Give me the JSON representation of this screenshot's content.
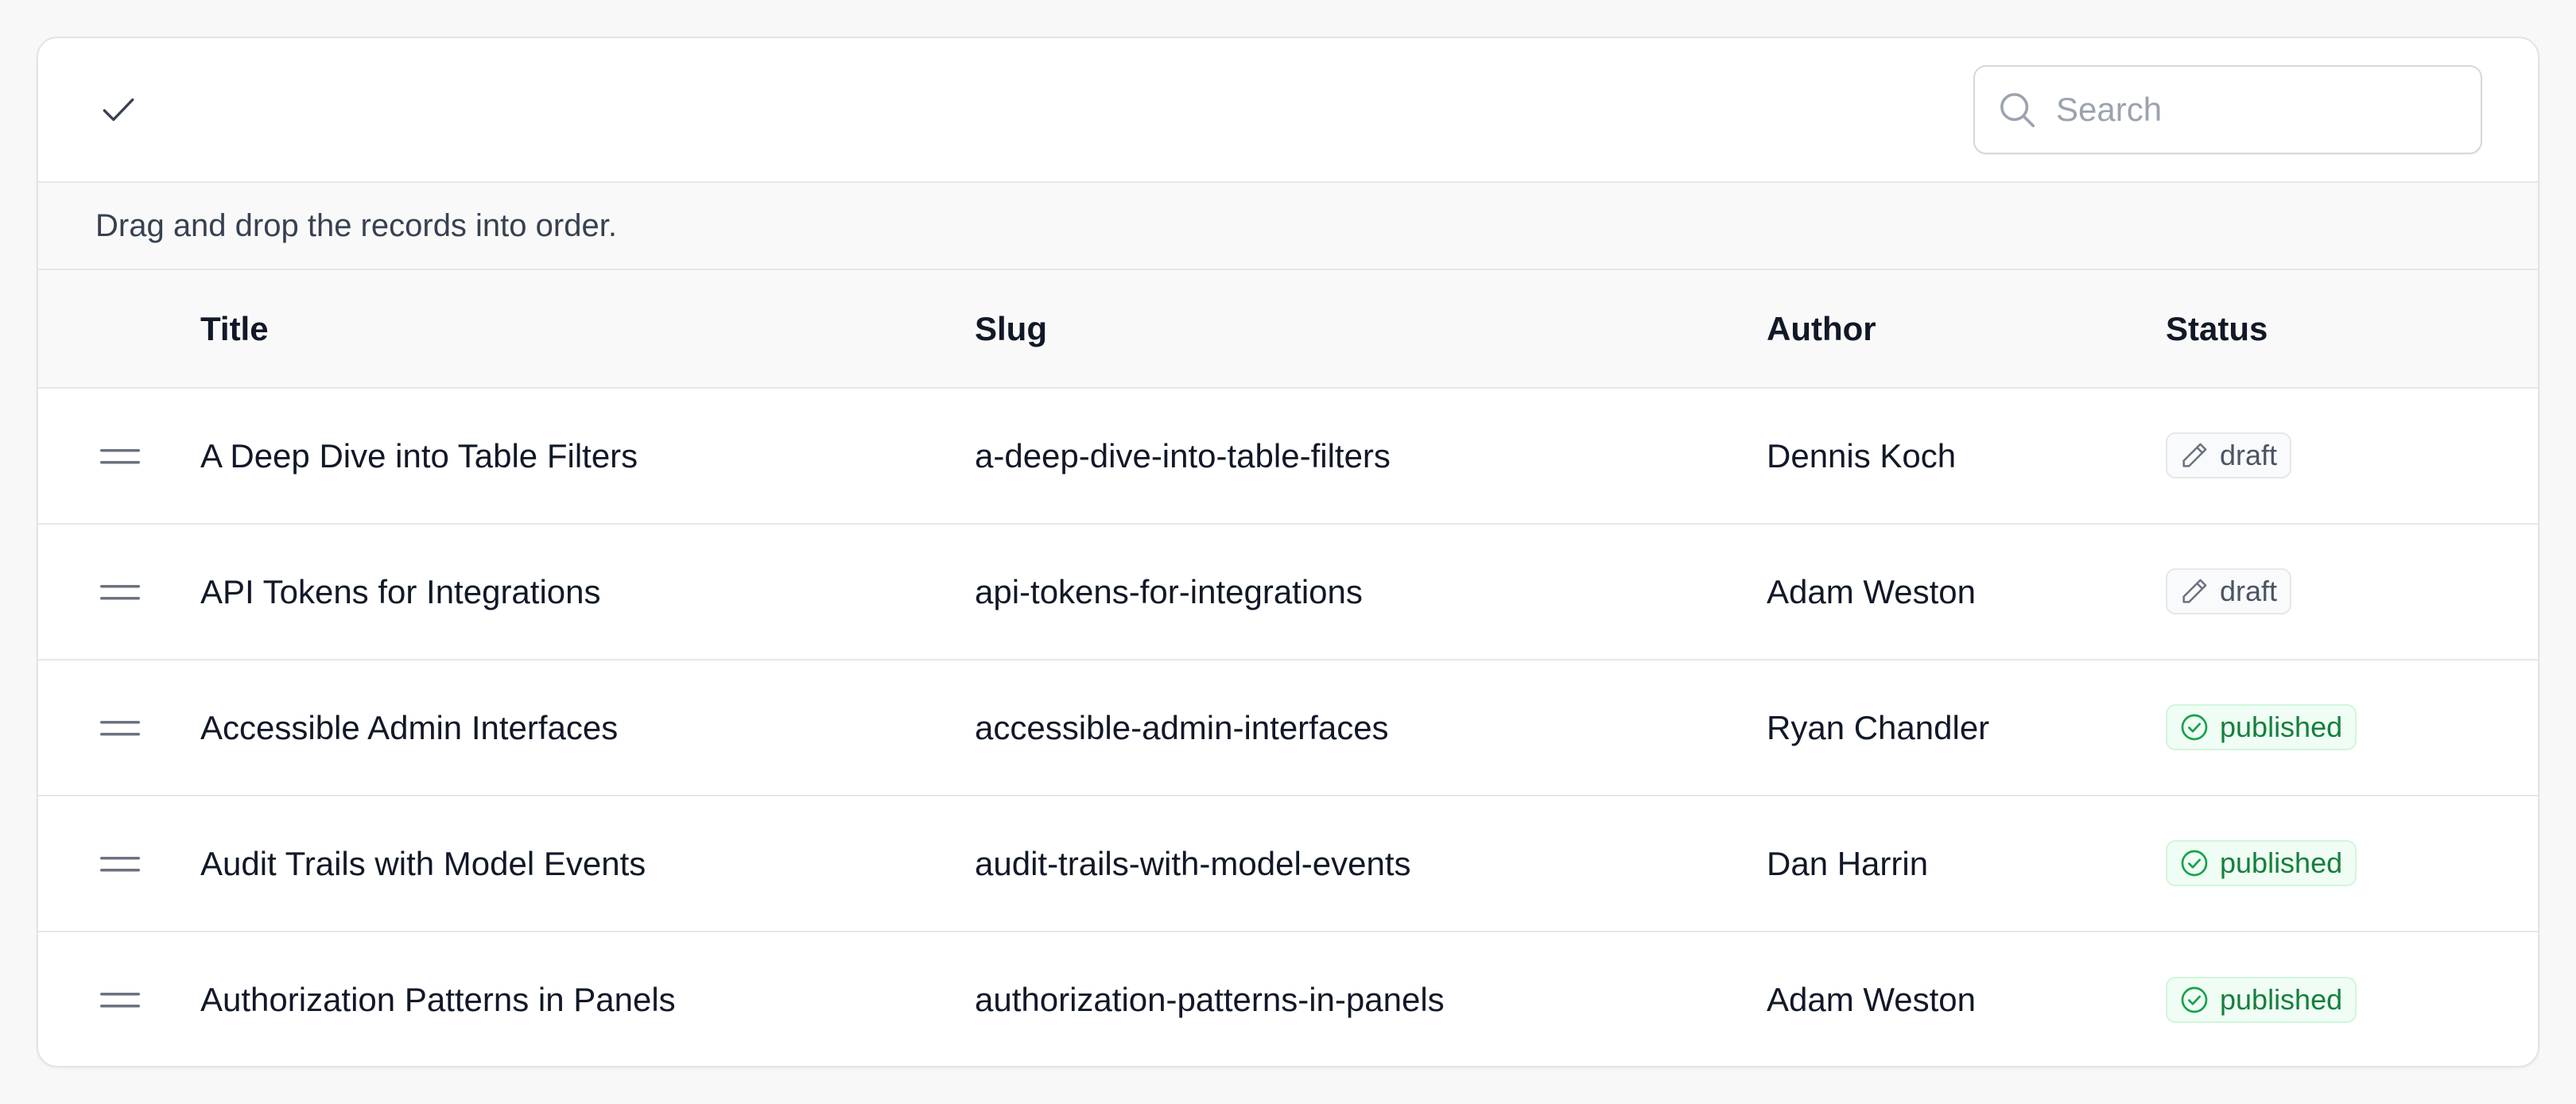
{
  "toolbar": {
    "confirm_icon": "check-icon",
    "search": {
      "placeholder": "Search",
      "value": "",
      "icon": "search-icon"
    }
  },
  "hint": "Drag and drop the records into order.",
  "table": {
    "columns": [
      "Title",
      "Slug",
      "Author",
      "Status"
    ],
    "rows": [
      {
        "title": "A Deep Dive into Table Filters",
        "slug": "a-deep-dive-into-table-filters",
        "author": "Dennis Koch",
        "status": "draft",
        "status_icon": "pencil-icon"
      },
      {
        "title": "API Tokens for Integrations",
        "slug": "api-tokens-for-integrations",
        "author": "Adam Weston",
        "status": "draft",
        "status_icon": "pencil-icon"
      },
      {
        "title": "Accessible Admin Interfaces",
        "slug": "accessible-admin-interfaces",
        "author": "Ryan Chandler",
        "status": "published",
        "status_icon": "check-circle-icon"
      },
      {
        "title": "Audit Trails with Model Events",
        "slug": "audit-trails-with-model-events",
        "author": "Dan Harrin",
        "status": "published",
        "status_icon": "check-circle-icon"
      },
      {
        "title": "Authorization Patterns in Panels",
        "slug": "authorization-patterns-in-panels",
        "author": "Adam Weston",
        "status": "published",
        "status_icon": "check-circle-icon"
      }
    ]
  },
  "colors": {
    "draft_text": "#4b5563",
    "published_text": "#15803d",
    "published_bg": "#f0fdf4"
  }
}
